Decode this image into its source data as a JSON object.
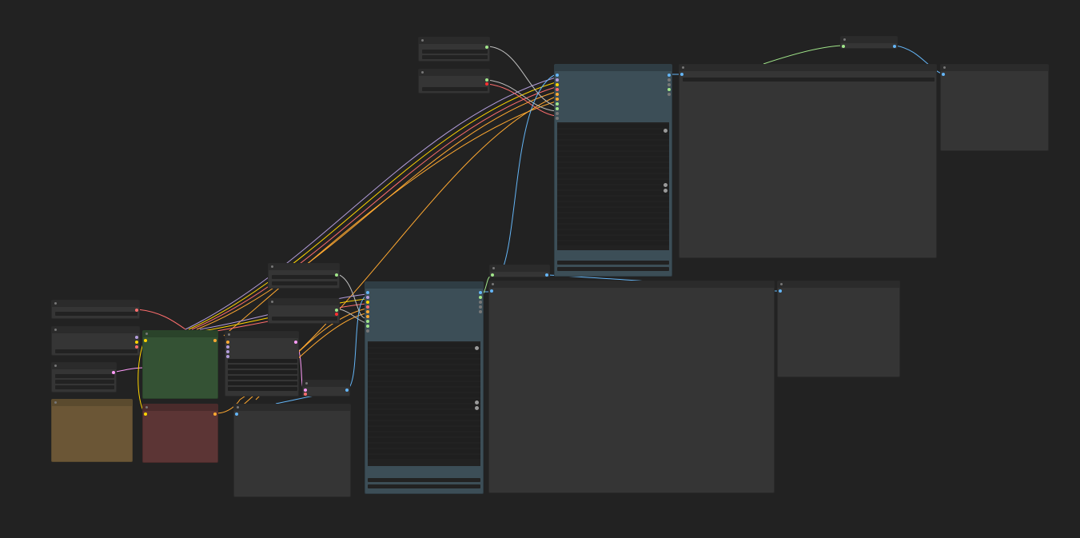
{
  "canvas": {
    "background": "#222222",
    "node_color": "#353535",
    "title_color": "#2b2b2b",
    "sampler_color": "#3c4e57",
    "model_group_color": "#345234",
    "negative_color": "#5c3535",
    "note_color": "#6b5636"
  },
  "wire_colors": {
    "model": "#b39ddb",
    "clip": "#ffd500",
    "vae": "#ff6e6e",
    "conditioning": "#ffa931",
    "latent": "#ff9cf9",
    "image": "#64b5f6",
    "int": "#a1e68a",
    "misc": "#c0c0c0"
  },
  "icons": {
    "node_collapse": "dot-icon",
    "slot": "circle-icon",
    "toggle": "knob-icon"
  }
}
